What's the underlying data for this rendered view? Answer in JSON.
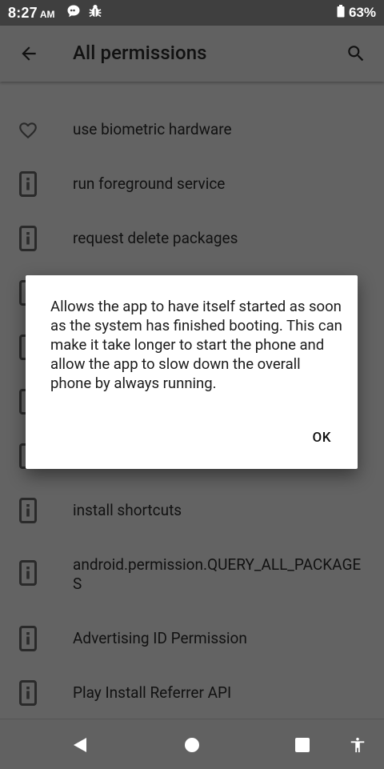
{
  "status_bar": {
    "time": "8:27",
    "ampm": "AM",
    "battery": "63%"
  },
  "app_bar": {
    "title": "All permissions"
  },
  "permissions": [
    {
      "label": "use biometric hardware",
      "icon": "heart-icon"
    },
    {
      "label": "run foreground service",
      "icon": "info-phone-icon"
    },
    {
      "label": "request delete packages",
      "icon": "info-phone-icon"
    },
    {
      "label": "",
      "icon": "info-phone-icon"
    },
    {
      "label": "",
      "icon": "info-phone-icon"
    },
    {
      "label": "",
      "icon": "info-phone-icon"
    },
    {
      "label": "",
      "icon": "info-phone-icon"
    },
    {
      "label": "install shortcuts",
      "icon": "info-phone-icon"
    },
    {
      "label": "android.permission.QUERY_ALL_PACKAGES",
      "icon": "info-phone-icon"
    },
    {
      "label": "Advertising ID Permission",
      "icon": "info-phone-icon"
    },
    {
      "label": "Play Install Referrer API",
      "icon": "info-phone-icon"
    }
  ],
  "dialog": {
    "message": "Allows the app to have itself started as soon as the system has finished booting. This can make it take longer to start the phone and allow the app to slow down the overall phone by always running.",
    "ok_label": "OK"
  },
  "nav": {
    "icons": [
      "back-triangle-icon",
      "home-circle-icon",
      "recents-square-icon",
      "accessibility-icon"
    ]
  }
}
